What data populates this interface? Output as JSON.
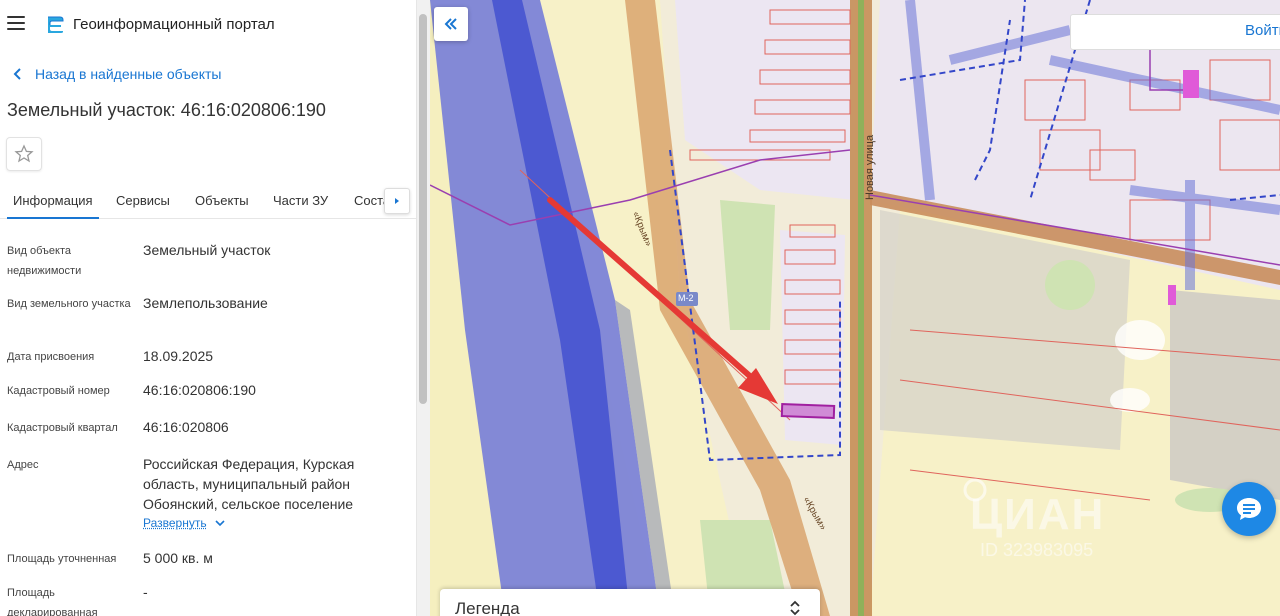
{
  "header": {
    "app_title": "Геоинформационный портал"
  },
  "nav": {
    "back_label": "Назад в найденные объекты"
  },
  "object": {
    "title": "Земельный участок: 46:16:020806:190"
  },
  "tabs": [
    {
      "label": "Информация",
      "active": true
    },
    {
      "label": "Сервисы",
      "active": false
    },
    {
      "label": "Объекты",
      "active": false
    },
    {
      "label": "Части ЗУ",
      "active": false
    },
    {
      "label": "Соста",
      "active": false
    }
  ],
  "details": {
    "object_type": {
      "label": "Вид объекта недвижимости",
      "value": "Земельный участок"
    },
    "parcel_type": {
      "label": "Вид земельного участка",
      "value": "Землепользование"
    },
    "assign_date": {
      "label": "Дата присвоения",
      "value": "18.09.2025"
    },
    "cadastral_number": {
      "label": "Кадастровый номер",
      "value": "46:16:020806:190"
    },
    "cadastral_block": {
      "label": "Кадастровый квартал",
      "value": "46:16:020806"
    },
    "address": {
      "label": "Адрес",
      "value": "Российская Федерация, Курская область, муниципальный район Обоянский, сельское поселение",
      "expand_label": "Развернуть"
    },
    "area_specified": {
      "label": "Площадь уточненная",
      "value": "5 000 кв. м"
    },
    "area_declared": {
      "label": "Площадь декларированная",
      "value": "-"
    }
  },
  "map": {
    "login_label": "Войти",
    "legend_label": "Легенда",
    "street_labels": {
      "krym_1": "«Крым»",
      "krym_2": "«Крым»",
      "novaya": "Новая улица",
      "highway": "М-2"
    },
    "watermark_text": "ЦИАН",
    "watermark_code": "ID 323983095"
  },
  "colors": {
    "accent": "#1976d2",
    "parcel": "#a020a0",
    "arrow": "#e53935",
    "chat": "#1e88e5"
  }
}
